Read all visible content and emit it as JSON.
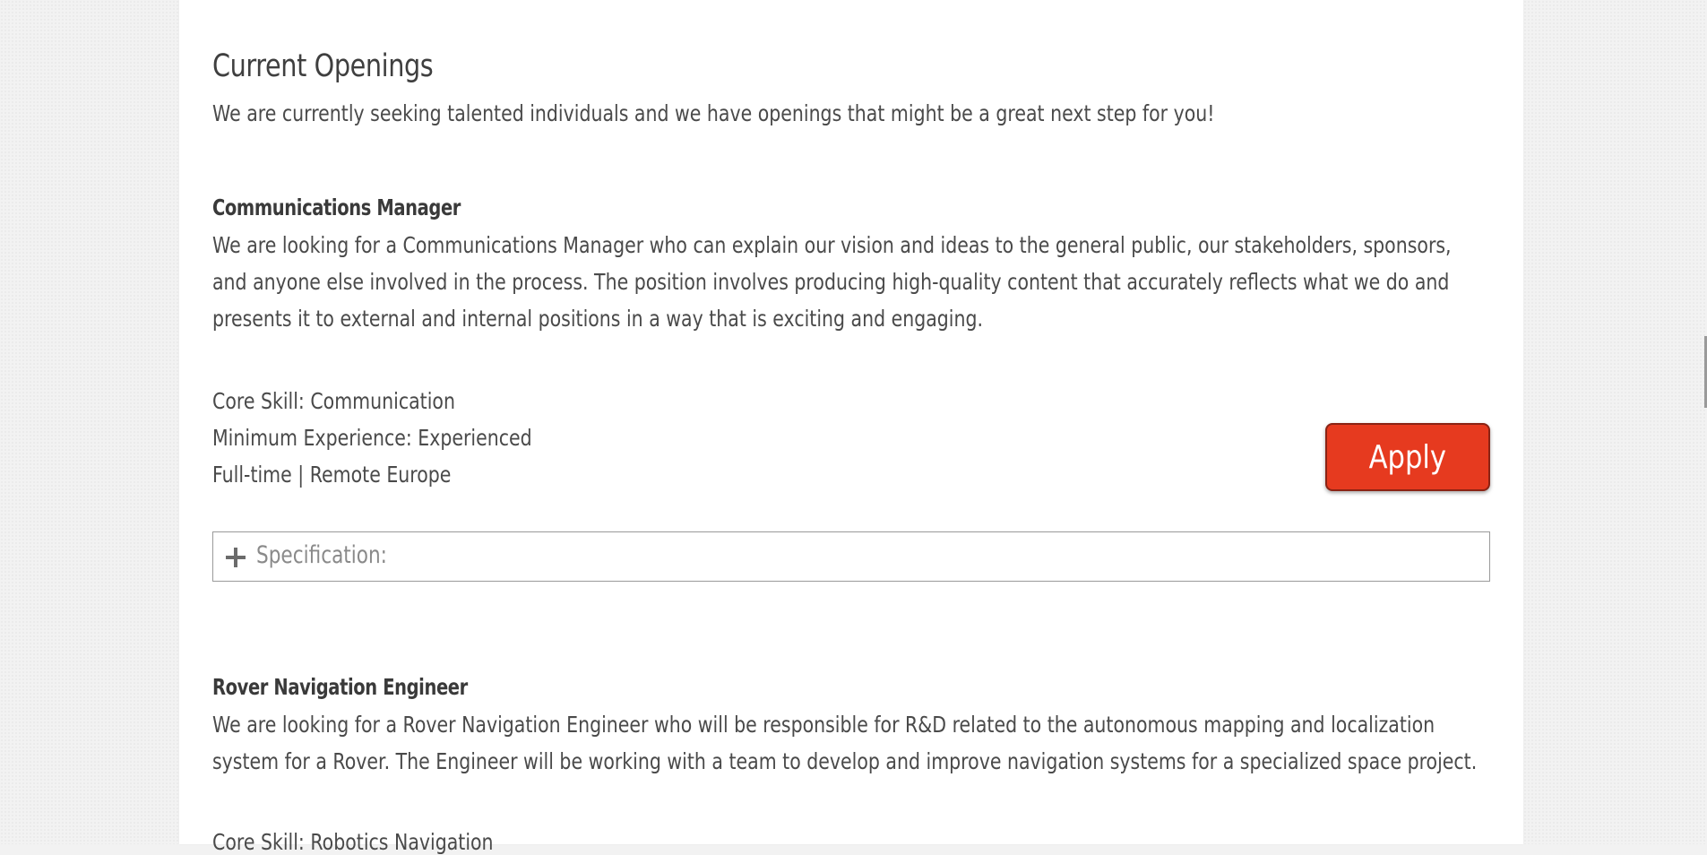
{
  "section": {
    "title": "Current Openings",
    "intro": "We are currently seeking talented individuals and we have openings that might be a great next step for you!"
  },
  "jobs": [
    {
      "title": "Communications Manager",
      "description": "We are looking for a Communications Manager who can explain our vision and ideas to the general public, our stakeholders, sponsors, and anyone else involved in the process. The position involves producing high-quality content that accurately reflects what we do and presents it to external and internal positions in a way that is exciting and engaging.",
      "core_skill": "Core Skill: Communication",
      "min_experience": "Minimum Experience: Experienced",
      "employment": "Full-time | Remote Europe",
      "apply_label": "Apply",
      "spec_label": "Specification:"
    },
    {
      "title": "Rover Navigation Engineer",
      "description": "We are looking for a Rover Navigation Engineer who will be responsible for R&D related to the autonomous mapping and localization system for a Rover. The Engineer will be working with a team to develop and improve navigation systems for a specialized space project.",
      "core_skill": "Core Skill: Robotics Navigation"
    }
  ],
  "colors": {
    "apply_bg": "#e63a1f",
    "page_bg": "#ffffff",
    "outer_bg": "#f2f2f2"
  },
  "icons": {
    "spec_toggle": "plus-icon"
  }
}
